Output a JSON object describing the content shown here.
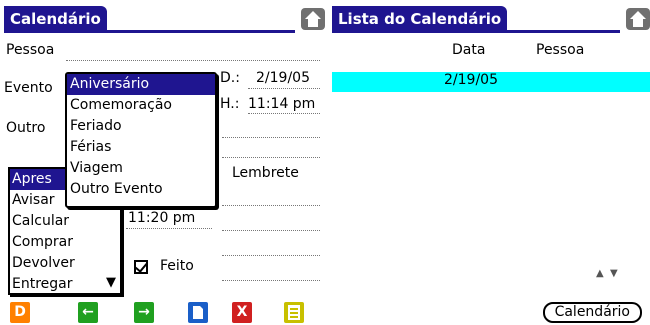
{
  "left": {
    "title": "Calendário",
    "fields": {
      "pessoa_label": "Pessoa",
      "evento_label": "Evento",
      "outro_label": "Outro",
      "date_prefix": "D.:",
      "date_value": "2/19/05",
      "hour_prefix": "H.:",
      "hour_value": "11:14 pm",
      "lembrete_label": "Lembrete",
      "alarm_time": "11:20 pm",
      "feito_label": "Feito",
      "feito_checked": true
    },
    "event_options": [
      "Aniversário",
      "Comemoração",
      "Feriado",
      "Férias",
      "Viagem",
      "Outro Evento"
    ],
    "event_selected": "Aniversário",
    "reminder_options": [
      "Apresentar",
      "Avisar",
      "Calcular",
      "Comprar",
      "Devolver",
      "Entregar"
    ],
    "reminder_selected_display": "Apres",
    "toolbar": [
      {
        "icon": "letter-d-icon",
        "glyph": "D",
        "color": "#ff8000"
      },
      {
        "icon": "arrow-left-icon",
        "glyph": "←",
        "color": "#20a020"
      },
      {
        "icon": "arrow-right-icon",
        "glyph": "→",
        "color": "#20a020"
      },
      {
        "icon": "new-document-icon",
        "glyph": "",
        "color": "#1a5fc8"
      },
      {
        "icon": "delete-x-icon",
        "glyph": "X",
        "color": "#d02020"
      },
      {
        "icon": "notes-icon",
        "glyph": "",
        "color": "#c8c000"
      }
    ]
  },
  "right": {
    "title": "Lista do Calendário",
    "columns": [
      "Data",
      "Pessoa"
    ],
    "rows": [
      {
        "data": "2/19/05",
        "pessoa": ""
      }
    ],
    "button_label": "Calendário"
  },
  "colors": {
    "title_bar": "#1f1590",
    "row_highlight": "#00ffff"
  }
}
